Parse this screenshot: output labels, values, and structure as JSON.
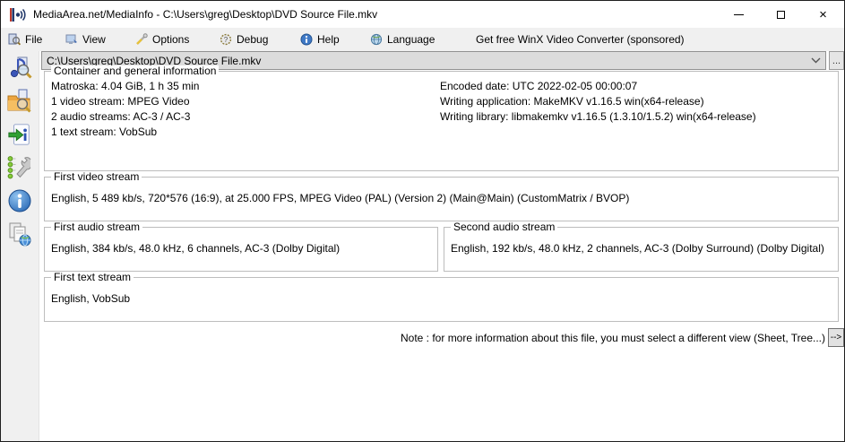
{
  "window": {
    "title": "MediaArea.net/MediaInfo - C:\\Users\\greg\\Desktop\\DVD Source File.mkv",
    "controls": {
      "close_glyph": "×"
    }
  },
  "menu": {
    "items": [
      {
        "label": "File"
      },
      {
        "label": "View"
      },
      {
        "label": "Options"
      },
      {
        "label": "Debug"
      },
      {
        "label": "Help"
      },
      {
        "label": "Language"
      }
    ],
    "sponsored": "Get free WinX Video Converter (sponsored)"
  },
  "toolbar": {
    "file_path": "C:\\Users\\greg\\Desktop\\DVD Source File.mkv",
    "browse_label": "..."
  },
  "sections": {
    "general": {
      "title": "Container and general information",
      "left_lines": [
        "Matroska: 4.04 GiB, 1 h 35 min",
        "1 video stream: MPEG Video",
        "2 audio streams: AC-3 / AC-3",
        "1 text stream: VobSub"
      ],
      "right_lines": [
        "Encoded date: UTC 2022-02-05 00:00:07",
        "Writing application: MakeMKV v1.16.5 win(x64-release)",
        "Writing library: libmakemkv v1.16.5 (1.3.10/1.5.2) win(x64-release)"
      ]
    },
    "video": {
      "title": "First video stream",
      "line": "English, 5 489 kb/s, 720*576 (16:9), at 25.000 FPS, MPEG Video (PAL) (Version 2) (Main@Main) (CustomMatrix / BVOP)"
    },
    "audio1": {
      "title": "First audio stream",
      "line": "English, 384 kb/s, 48.0 kHz, 6 channels, AC-3 (Dolby Digital)"
    },
    "audio2": {
      "title": "Second audio stream",
      "line": "English, 192 kb/s, 48.0 kHz, 2 channels, AC-3 (Dolby Surround) (Dolby Digital)"
    },
    "text": {
      "title": "First text stream",
      "line": "English, VobSub"
    },
    "note": {
      "text": "Note : for more information about this file, you must select a different view (Sheet, Tree...)",
      "button_label": "-->"
    }
  }
}
